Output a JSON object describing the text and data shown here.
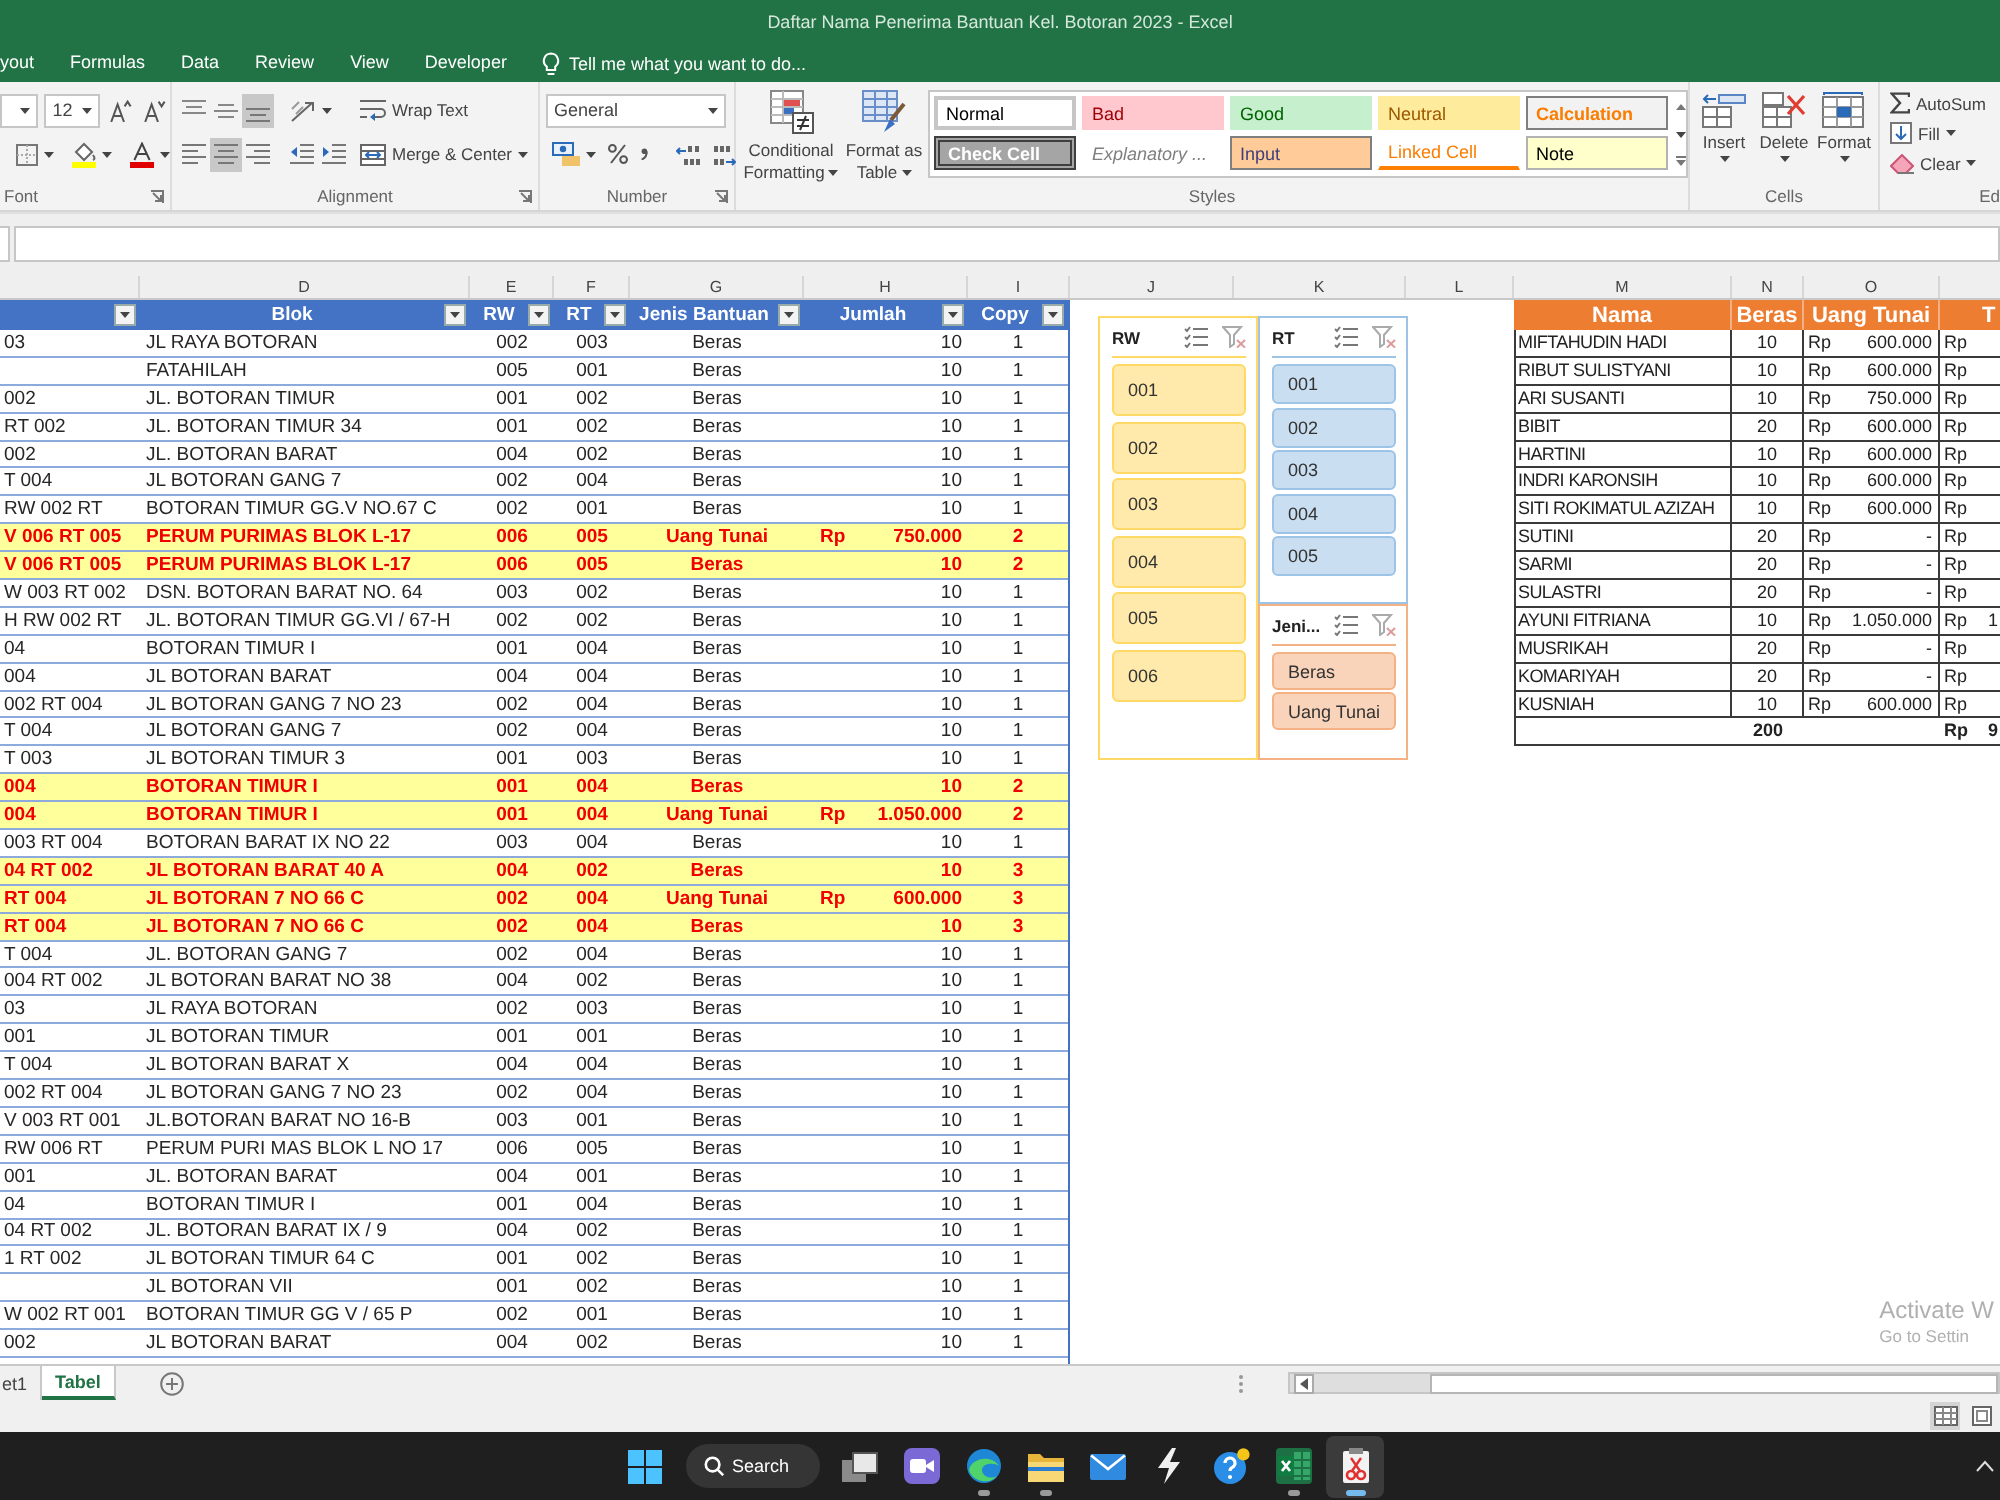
{
  "window": {
    "title": "Daftar Nama Penerima Bantuan Kel. Botoran 2023 - Excel"
  },
  "ribbon_tabs": [
    {
      "label": "yout",
      "selected": false
    },
    {
      "label": "Formulas",
      "selected": false
    },
    {
      "label": "Data",
      "selected": false
    },
    {
      "label": "Review",
      "selected": false
    },
    {
      "label": "View",
      "selected": false
    },
    {
      "label": "Developer",
      "selected": false
    }
  ],
  "tell_me": {
    "placeholder": "Tell me what you want to do..."
  },
  "ribbon": {
    "font": {
      "label": "Font",
      "size": "12"
    },
    "alignment": {
      "label": "Alignment",
      "vertical": [
        {
          "kind": "top",
          "selected": false
        },
        {
          "kind": "middle",
          "selected": false
        },
        {
          "kind": "bottom",
          "selected": true
        }
      ],
      "horizontal": [
        {
          "kind": "left",
          "selected": false
        },
        {
          "kind": "center",
          "selected": true
        },
        {
          "kind": "right",
          "selected": false
        }
      ],
      "wrap_text": "Wrap Text",
      "merge": "Merge & Center"
    },
    "number": {
      "label": "Number",
      "format": "General"
    },
    "styles": {
      "label": "Styles",
      "conditional_formatting": "Conditional Formatting",
      "format_as_table": "Format as Table",
      "cell_styles": [
        {
          "label": "Normal",
          "kind": "normal"
        },
        {
          "label": "Bad",
          "kind": "bad"
        },
        {
          "label": "Good",
          "kind": "good"
        },
        {
          "label": "Neutral",
          "kind": "neutral"
        },
        {
          "label": "Calculation",
          "kind": "calculation"
        },
        {
          "label": "Check Cell",
          "kind": "check"
        },
        {
          "label": "Explanatory ...",
          "kind": "explanatory"
        },
        {
          "label": "Input",
          "kind": "input"
        },
        {
          "label": "Linked Cell",
          "kind": "linked"
        },
        {
          "label": "Note",
          "kind": "note"
        }
      ]
    },
    "cells": {
      "label": "Cells",
      "buttons": [
        {
          "label": "Insert",
          "kind": "insert"
        },
        {
          "label": "Delete",
          "kind": "delete"
        },
        {
          "label": "Format",
          "kind": "format"
        }
      ]
    },
    "editing": {
      "label": "Ed",
      "buttons": [
        {
          "label": "AutoSum",
          "kind": "autosum"
        },
        {
          "label": "Fill",
          "kind": "fill"
        },
        {
          "label": "Clear",
          "kind": "clear"
        }
      ]
    }
  },
  "column_headers": [
    "D",
    "E",
    "F",
    "G",
    "H",
    "I",
    "J",
    "K",
    "L",
    "M",
    "N",
    "O"
  ],
  "data_table": {
    "columns": [
      {
        "filter": true
      },
      {
        "label": "Blok",
        "filter": true
      },
      {
        "label": "RW",
        "filter": true
      },
      {
        "label": "RT",
        "filter": true
      },
      {
        "label": "Jenis Bantuan",
        "filter": true
      },
      {
        "label": "Jumlah",
        "filter": true
      },
      {
        "label": "Copy",
        "filter": true
      }
    ],
    "rows": [
      {
        "column_1": "03",
        "blok": "JL RAYA BOTORAN",
        "rw": "002",
        "rt": "003",
        "jenis_bantuan": "Beras",
        "jumlah": "10",
        "copy": "1",
        "highlighted": false
      },
      {
        "blok": "FATAHILAH",
        "rw": "005",
        "rt": "001",
        "jenis_bantuan": "Beras",
        "jumlah": "10",
        "copy": "1",
        "highlighted": false
      },
      {
        "column_1": "002",
        "blok": "JL. BOTORAN TIMUR",
        "rw": "001",
        "rt": "002",
        "jenis_bantuan": "Beras",
        "jumlah": "10",
        "copy": "1",
        "highlighted": false
      },
      {
        "column_1": "RT 002",
        "blok": "JL. BOTORAN TIMUR 34",
        "rw": "001",
        "rt": "002",
        "jenis_bantuan": "Beras",
        "jumlah": "10",
        "copy": "1",
        "highlighted": false
      },
      {
        "column_1": "002",
        "blok": "JL. BOTORAN BARAT",
        "rw": "004",
        "rt": "002",
        "jenis_bantuan": "Beras",
        "jumlah": "10",
        "copy": "1",
        "highlighted": false
      },
      {
        "column_1": "T 004",
        "blok": "JL BOTORAN GANG 7",
        "rw": "002",
        "rt": "004",
        "jenis_bantuan": "Beras",
        "jumlah": "10",
        "copy": "1",
        "highlighted": false
      },
      {
        "column_1": "RW 002 RT",
        "blok": "BOTORAN TIMUR GG.V NO.67 C",
        "rw": "002",
        "rt": "001",
        "jenis_bantuan": "Beras",
        "jumlah": "10",
        "copy": "1",
        "highlighted": false
      },
      {
        "column_1": "V 006 RT 005",
        "blok": "PERUM PURIMAS BLOK L-17",
        "rw": "006",
        "rt": "005",
        "jenis_bantuan": "Uang Tunai",
        "currency": "Rp",
        "jumlah": "750.000",
        "copy": "2",
        "highlighted": true
      },
      {
        "column_1": "V 006 RT 005",
        "blok": "PERUM PURIMAS BLOK L-17",
        "rw": "006",
        "rt": "005",
        "jenis_bantuan": "Beras",
        "jumlah": "10",
        "copy": "2",
        "highlighted": true
      },
      {
        "column_1": "W 003 RT 002",
        "blok": "DSN. BOTORAN BARAT NO. 64",
        "rw": "003",
        "rt": "002",
        "jenis_bantuan": "Beras",
        "jumlah": "10",
        "copy": "1",
        "highlighted": false
      },
      {
        "column_1": "H RW 002 RT",
        "blok": "JL. BOTORAN TIMUR GG.VI / 67-H",
        "rw": "002",
        "rt": "002",
        "jenis_bantuan": "Beras",
        "jumlah": "10",
        "copy": "1",
        "highlighted": false
      },
      {
        "column_1": "04",
        "blok": "BOTORAN TIMUR I",
        "rw": "001",
        "rt": "004",
        "jenis_bantuan": "Beras",
        "jumlah": "10",
        "copy": "1",
        "highlighted": false
      },
      {
        "column_1": "004",
        "blok": "JL BOTORAN BARAT",
        "rw": "004",
        "rt": "004",
        "jenis_bantuan": "Beras",
        "jumlah": "10",
        "copy": "1",
        "highlighted": false
      },
      {
        "column_1": "002 RT 004",
        "blok": "JL BOTORAN GANG 7 NO 23",
        "rw": "002",
        "rt": "004",
        "jenis_bantuan": "Beras",
        "jumlah": "10",
        "copy": "1",
        "highlighted": false
      },
      {
        "column_1": "T 004",
        "blok": "JL BOTORAN GANG 7",
        "rw": "002",
        "rt": "004",
        "jenis_bantuan": "Beras",
        "jumlah": "10",
        "copy": "1",
        "highlighted": false
      },
      {
        "column_1": "T 003",
        "blok": "JL BOTORAN TIMUR 3",
        "rw": "001",
        "rt": "003",
        "jenis_bantuan": "Beras",
        "jumlah": "10",
        "copy": "1",
        "highlighted": false
      },
      {
        "column_1": "004",
        "blok": "BOTORAN TIMUR I",
        "rw": "001",
        "rt": "004",
        "jenis_bantuan": "Beras",
        "jumlah": "10",
        "copy": "2",
        "highlighted": true
      },
      {
        "column_1": "004",
        "blok": "BOTORAN TIMUR I",
        "rw": "001",
        "rt": "004",
        "jenis_bantuan": "Uang Tunai",
        "currency": "Rp",
        "jumlah": "1.050.000",
        "copy": "2",
        "highlighted": true
      },
      {
        "column_1": "003 RT 004",
        "blok": "BOTORAN BARAT IX NO 22",
        "rw": "003",
        "rt": "004",
        "jenis_bantuan": "Beras",
        "jumlah": "10",
        "copy": "1",
        "highlighted": false
      },
      {
        "column_1": "04 RT 002",
        "blok": "JL BOTORAN BARAT 40 A",
        "rw": "004",
        "rt": "002",
        "jenis_bantuan": "Beras",
        "jumlah": "10",
        "copy": "3",
        "highlighted": true
      },
      {
        "column_1": "RT 004",
        "blok": "JL BOTORAN 7 NO 66 C",
        "rw": "002",
        "rt": "004",
        "jenis_bantuan": "Uang Tunai",
        "currency": "Rp",
        "jumlah": "600.000",
        "copy": "3",
        "highlighted": true
      },
      {
        "column_1": "RT 004",
        "blok": "JL BOTORAN 7 NO 66 C",
        "rw": "002",
        "rt": "004",
        "jenis_bantuan": "Beras",
        "jumlah": "10",
        "copy": "3",
        "highlighted": true
      },
      {
        "column_1": "T 004",
        "blok": "JL. BOTORAN GANG 7",
        "rw": "002",
        "rt": "004",
        "jenis_bantuan": "Beras",
        "jumlah": "10",
        "copy": "1",
        "highlighted": false
      },
      {
        "column_1": "004 RT 002",
        "blok": "JL BOTORAN BARAT NO 38",
        "rw": "004",
        "rt": "002",
        "jenis_bantuan": "Beras",
        "jumlah": "10",
        "copy": "1",
        "highlighted": false
      },
      {
        "column_1": "03",
        "blok": "JL RAYA BOTORAN",
        "rw": "002",
        "rt": "003",
        "jenis_bantuan": "Beras",
        "jumlah": "10",
        "copy": "1",
        "highlighted": false
      },
      {
        "column_1": "001",
        "blok": "JL BOTORAN TIMUR",
        "rw": "001",
        "rt": "001",
        "jenis_bantuan": "Beras",
        "jumlah": "10",
        "copy": "1",
        "highlighted": false
      },
      {
        "column_1": "T 004",
        "blok": "JL BOTORAN BARAT X",
        "rw": "004",
        "rt": "004",
        "jenis_bantuan": "Beras",
        "jumlah": "10",
        "copy": "1",
        "highlighted": false
      },
      {
        "column_1": "002 RT 004",
        "blok": "JL BOTORAN GANG 7 NO 23",
        "rw": "002",
        "rt": "004",
        "jenis_bantuan": "Beras",
        "jumlah": "10",
        "copy": "1",
        "highlighted": false
      },
      {
        "column_1": "V 003 RT 001",
        "blok": "JL.BOTORAN BARAT NO 16-B",
        "rw": "003",
        "rt": "001",
        "jenis_bantuan": "Beras",
        "jumlah": "10",
        "copy": "1",
        "highlighted": false
      },
      {
        "column_1": "RW 006 RT",
        "blok": "PERUM PURI MAS BLOK L NO 17",
        "rw": "006",
        "rt": "005",
        "jenis_bantuan": "Beras",
        "jumlah": "10",
        "copy": "1",
        "highlighted": false
      },
      {
        "column_1": "001",
        "blok": "JL. BOTORAN BARAT",
        "rw": "004",
        "rt": "001",
        "jenis_bantuan": "Beras",
        "jumlah": "10",
        "copy": "1",
        "highlighted": false
      },
      {
        "column_1": "04",
        "blok": "BOTORAN TIMUR I",
        "rw": "001",
        "rt": "004",
        "jenis_bantuan": "Beras",
        "jumlah": "10",
        "copy": "1",
        "highlighted": false
      },
      {
        "column_1": "04 RT 002",
        "blok": "JL. BOTORAN BARAT IX / 9",
        "rw": "004",
        "rt": "002",
        "jenis_bantuan": "Beras",
        "jumlah": "10",
        "copy": "1",
        "highlighted": false
      },
      {
        "column_1": "1 RT 002",
        "blok": "JL BOTORAN TIMUR 64 C",
        "rw": "001",
        "rt": "002",
        "jenis_bantuan": "Beras",
        "jumlah": "10",
        "copy": "1",
        "highlighted": false
      },
      {
        "blok": "JL BOTORAN VII",
        "rw": "001",
        "rt": "002",
        "jenis_bantuan": "Beras",
        "jumlah": "10",
        "copy": "1",
        "highlighted": false
      },
      {
        "column_1": "W 002 RT 001",
        "blok": "BOTORAN TIMUR GG V / 65 P",
        "rw": "002",
        "rt": "001",
        "jenis_bantuan": "Beras",
        "jumlah": "10",
        "copy": "1",
        "highlighted": false
      },
      {
        "column_1": "002",
        "blok": "JL BOTORAN BARAT",
        "rw": "004",
        "rt": "002",
        "jenis_bantuan": "Beras",
        "jumlah": "10",
        "copy": "1",
        "highlighted": false
      }
    ]
  },
  "slicers": [
    {
      "title": "RW",
      "color": "#ffd966",
      "items": [
        {
          "label": "001",
          "selected": true
        },
        {
          "label": "002",
          "selected": true
        },
        {
          "label": "003",
          "selected": true
        },
        {
          "label": "004",
          "selected": true
        },
        {
          "label": "005",
          "selected": true
        },
        {
          "label": "006",
          "selected": true
        }
      ]
    },
    {
      "title": "RT",
      "color": "#9dc3e6",
      "items": [
        {
          "label": "001",
          "selected": true
        },
        {
          "label": "002",
          "selected": true
        },
        {
          "label": "003",
          "selected": true
        },
        {
          "label": "004",
          "selected": true
        },
        {
          "label": "005",
          "selected": true
        }
      ]
    },
    {
      "title": "Jeni...",
      "color": "#f4b183",
      "items": [
        {
          "label": "Beras",
          "selected": true
        },
        {
          "label": "Uang Tunai",
          "selected": true
        }
      ]
    }
  ],
  "summary_table": {
    "columns": [
      "Nama",
      "Beras",
      "Uang Tunai",
      "T"
    ],
    "rows": [
      {
        "nama": "MIFTAHUDIN HADI",
        "beras": "10",
        "uang_tunai_currency": "Rp",
        "uang_tunai": "600.000",
        "column_4_currency": "Rp"
      },
      {
        "nama": "RIBUT SULISTYANI",
        "beras": "10",
        "uang_tunai_currency": "Rp",
        "uang_tunai": "600.000",
        "column_4_currency": "Rp"
      },
      {
        "nama": "ARI SUSANTI",
        "beras": "10",
        "uang_tunai_currency": "Rp",
        "uang_tunai": "750.000",
        "column_4_currency": "Rp"
      },
      {
        "nama": "BIBIT",
        "beras": "20",
        "uang_tunai_currency": "Rp",
        "uang_tunai": "600.000",
        "column_4_currency": "Rp"
      },
      {
        "nama": "HARTINI",
        "beras": "10",
        "uang_tunai_currency": "Rp",
        "uang_tunai": "600.000",
        "column_4_currency": "Rp"
      },
      {
        "nama": "INDRI KARONSIH",
        "beras": "10",
        "uang_tunai_currency": "Rp",
        "uang_tunai": "600.000",
        "column_4_currency": "Rp"
      },
      {
        "nama": "SITI ROKIMATUL AZIZAH",
        "beras": "10",
        "uang_tunai_currency": "Rp",
        "uang_tunai": "600.000",
        "column_4_currency": "Rp"
      },
      {
        "nama": "SUTINI",
        "beras": "20",
        "uang_tunai_currency": "Rp",
        "uang_tunai": "-",
        "column_4_currency": "Rp"
      },
      {
        "nama": "SARMI",
        "beras": "20",
        "uang_tunai_currency": "Rp",
        "uang_tunai": "-",
        "column_4_currency": "Rp"
      },
      {
        "nama": "SULASTRI",
        "beras": "20",
        "uang_tunai_currency": "Rp",
        "uang_tunai": "-",
        "column_4_currency": "Rp"
      },
      {
        "nama": "AYUNI FITRIANA",
        "beras": "10",
        "uang_tunai_currency": "Rp",
        "uang_tunai": "1.050.000",
        "column_4_currency": "Rp",
        "column_4": "1"
      },
      {
        "nama": "MUSRIKAH",
        "beras": "20",
        "uang_tunai_currency": "Rp",
        "uang_tunai": "-",
        "column_4_currency": "Rp"
      },
      {
        "nama": "KOMARIYAH",
        "beras": "20",
        "uang_tunai_currency": "Rp",
        "uang_tunai": "-",
        "column_4_currency": "Rp"
      },
      {
        "nama": "KUSNIAH",
        "beras": "10",
        "uang_tunai_currency": "Rp",
        "uang_tunai": "600.000",
        "column_4_currency": "Rp"
      }
    ],
    "total": {
      "beras": "200",
      "column_4_currency": "Rp",
      "column_4": "9"
    }
  },
  "sheet_tabs": [
    {
      "label": "et1",
      "selected": false
    },
    {
      "label": "Tabel",
      "selected": true
    }
  ],
  "status_bar": {
    "views": [
      {
        "kind": "normal",
        "selected": true
      },
      {
        "kind": "layout",
        "selected": false
      }
    ]
  },
  "activation_notice": {
    "title": "Activate W",
    "subtitle": "Go to Settin"
  },
  "taskbar": {
    "search": {
      "placeholder": "Search"
    },
    "apps": [
      {
        "kind": "taskview",
        "running": false,
        "active": false
      },
      {
        "kind": "chat",
        "running": false,
        "active": false
      },
      {
        "kind": "browser",
        "running": true,
        "active": false
      },
      {
        "kind": "folder",
        "running": true,
        "active": false
      },
      {
        "kind": "mail",
        "running": false,
        "active": false
      },
      {
        "kind": "lightning",
        "running": false,
        "active": false
      },
      {
        "kind": "help",
        "running": false,
        "active": false
      },
      {
        "kind": "spreadsheet",
        "running": true,
        "active": false
      },
      {
        "kind": "snipping",
        "running": true,
        "active": true
      }
    ]
  }
}
